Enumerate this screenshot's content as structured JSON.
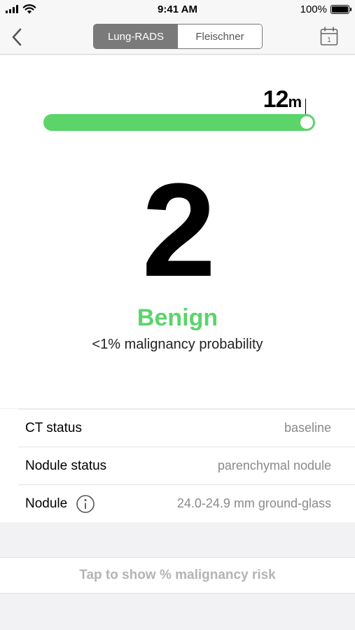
{
  "status_bar": {
    "time": "9:41 AM",
    "battery_text": "100%"
  },
  "nav": {
    "segments": [
      {
        "label": "Lung-RADS",
        "active": true
      },
      {
        "label": "Fleischner",
        "active": false
      }
    ],
    "icons": {
      "back": "chevron-left-icon",
      "calendar": "calendar-icon"
    },
    "calendar_day": "1"
  },
  "followup_slider": {
    "value": "12",
    "unit": "m",
    "fraction": 0.97
  },
  "result": {
    "score": "2",
    "category": "Benign",
    "probability": "<1% malignancy probability",
    "category_color": "#5bd46a"
  },
  "details": [
    {
      "label": "CT status",
      "value": "baseline",
      "has_info": false
    },
    {
      "label": "Nodule status",
      "value": "parenchymal nodule",
      "has_info": false
    },
    {
      "label": "Nodule",
      "value": "24.0-24.9 mm ground-glass",
      "has_info": true
    }
  ],
  "tap_button": {
    "label": "Tap to show % malignancy risk"
  },
  "colors": {
    "accent_green": "#5bd46a",
    "segment_active": "#7a7a7a",
    "muted_text": "#8a8a8a"
  }
}
